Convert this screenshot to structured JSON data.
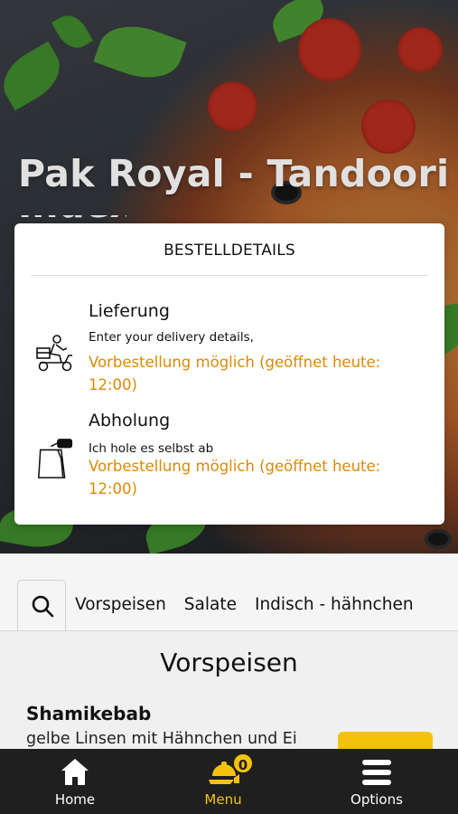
{
  "restaurant": {
    "name": "Pak Royal - Tandoori",
    "name_cut": "Index"
  },
  "order_details": {
    "title": "BESTELLDETAILS",
    "options": [
      {
        "icon": "delivery-scooter-icon",
        "title": "Lieferung",
        "subtitle": "Enter your delivery details,",
        "note": "Vorbestellung möglich (geöffnet heute: 12:00)"
      },
      {
        "icon": "takeaway-bag-icon",
        "title": "Abholung",
        "subtitle": "Ich hole es selbst ab",
        "note": "Vorbestellung möglich (geöffnet heute: 12:00)"
      }
    ]
  },
  "categories": {
    "search_icon": "search-icon",
    "items": [
      "Vorspeisen",
      "Salate",
      "Indisch - hähnchen"
    ]
  },
  "menu": {
    "section_title": "Vorspeisen",
    "items": [
      {
        "name": "Shamikebab",
        "description": "gelbe Linsen mit Hähnchen und Ei"
      }
    ]
  },
  "bottom_nav": {
    "items": [
      {
        "icon": "home-icon",
        "label": "Home"
      },
      {
        "icon": "cloche-icon",
        "label": "Menu",
        "badge": "0"
      },
      {
        "icon": "hamburger-menu-icon",
        "label": "Options"
      }
    ]
  },
  "colors": {
    "accent": "#f4c20d",
    "note_orange": "#d98a06",
    "nav_bg": "#1f1f1f"
  }
}
